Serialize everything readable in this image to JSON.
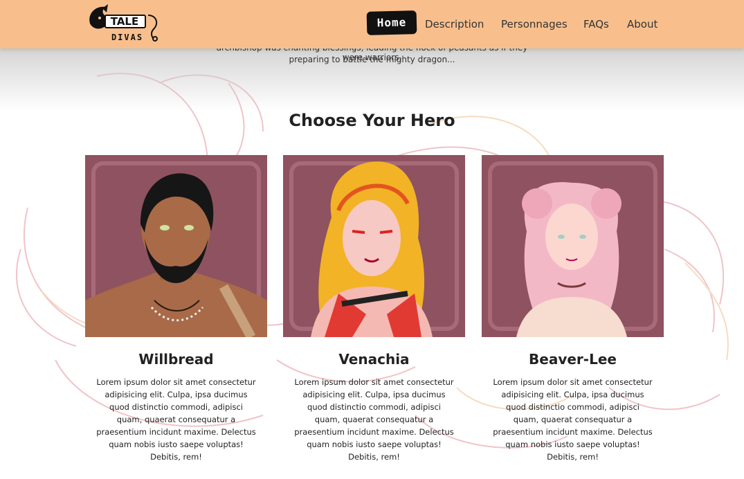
{
  "header": {
    "logo_text": "TALE DIVAS",
    "nav": {
      "home": "Home",
      "description": "Description",
      "personnages": "Personnages",
      "faqs": "FAQs",
      "about": "About"
    }
  },
  "intro": {
    "line1": "archbishop was chanting blessings, leading the flock of peasants as if they were warriors,",
    "line2": "preparing to battle the mighty dragon..."
  },
  "section": {
    "title": "Choose Your Hero"
  },
  "heroes": [
    {
      "name": "Willbread",
      "description": "Lorem ipsum dolor sit amet consectetur adipisicing elit. Culpa, ipsa ducimus quod distinctio commodi, adipisci quam, quaerat consequatur a praesentium incidunt maxime. Delectus quam nobis iusto saepe voluptas! Debitis, rem!"
    },
    {
      "name": "Venachia",
      "description": "Lorem ipsum dolor sit amet consectetur adipisicing elit. Culpa, ipsa ducimus quod distinctio commodi, adipisci quam, quaerat consequatur a praesentium incidunt maxime. Delectus quam nobis iusto saepe voluptas! Debitis, rem!"
    },
    {
      "name": "Beaver-Lee",
      "description": "Lorem ipsum dolor sit amet consectetur adipisicing elit. Culpa, ipsa ducimus quod distinctio commodi, adipisci quam, quaerat consequatur a praesentium incidunt maxime. Delectus quam nobis iusto saepe voluptas! Debitis, rem!"
    }
  ],
  "colors": {
    "navbar": "#f8bf8d",
    "portrait_frame": "#8f5260",
    "background_art": "#f2c6cc"
  }
}
